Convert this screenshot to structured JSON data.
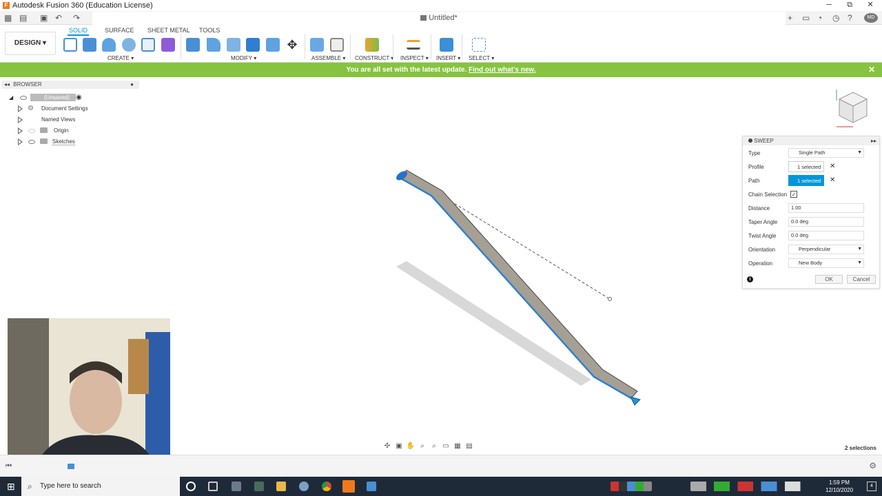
{
  "window": {
    "title": "Autodesk Fusion 360 (Education License)",
    "document_tab": "Untitled*",
    "controls": {
      "minimize": "─",
      "restore": "⧉",
      "close": "✕"
    }
  },
  "toolbar": {
    "workspace": "DESIGN ▾",
    "mode_tabs": [
      "SOLID",
      "SURFACE",
      "SHEET METAL",
      "TOOLS"
    ],
    "groups": [
      "CREATE ▾",
      "MODIFY ▾",
      "ASSEMBLE ▾",
      "CONSTRUCT ▾",
      "INSPECT ▾",
      "INSERT ▾",
      "SELECT ▾"
    ]
  },
  "banner": {
    "message": "You are all set with the latest update.",
    "link": "Find out what's new.",
    "close": "✕"
  },
  "browser": {
    "title": "BROWSER",
    "root": "(Unsaved)",
    "items": [
      "Document Settings",
      "Named Views",
      "Origin",
      "Sketches"
    ]
  },
  "sweep_dialog": {
    "title": "SWEEP",
    "rows": [
      {
        "label": "Type",
        "value": "Single Path"
      },
      {
        "label": "Profile",
        "value": "1 selected"
      },
      {
        "label": "Path",
        "value": "1 selected"
      },
      {
        "label": "Chain Selection",
        "value": "✓"
      },
      {
        "label": "Distance",
        "value": "1.00"
      },
      {
        "label": "Taper Angle",
        "value": "0.0 deg"
      },
      {
        "label": "Twist Angle",
        "value": "0.0 deg"
      },
      {
        "label": "Orientation",
        "value": "Perpendicular"
      },
      {
        "label": "Operation",
        "value": "New Body"
      }
    ],
    "ok": "OK",
    "cancel": "Cancel"
  },
  "status": {
    "selections": "2 selections"
  },
  "taskbar": {
    "search_placeholder": "Type here to search",
    "time": "1:59 PM",
    "date": "12/10/2020"
  },
  "colors": {
    "accent": "#0696d7",
    "banner": "#86c340",
    "taskbar": "#1f2a38"
  }
}
